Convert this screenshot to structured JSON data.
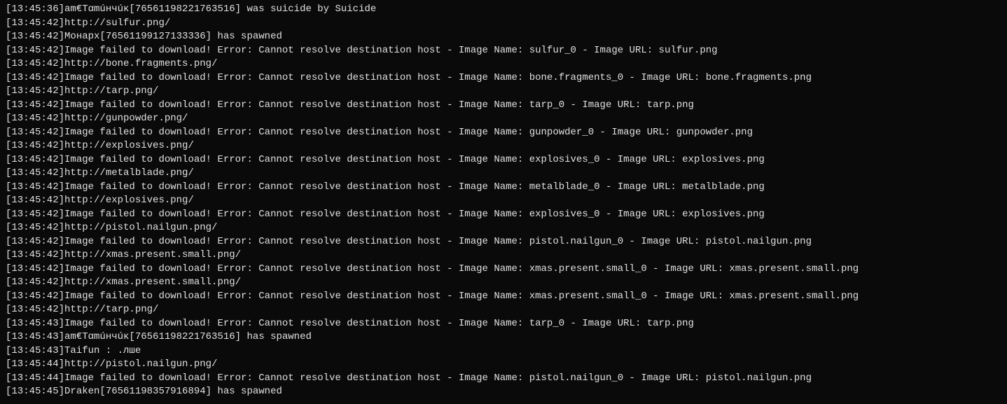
{
  "console": {
    "lines": [
      {
        "ts": "[13:45:36]",
        "text": "am€Tαmúнчúĸ[76561198221763516] was suicide by Suicide"
      },
      {
        "ts": "[13:45:42]",
        "text": "http://sulfur.png/"
      },
      {
        "ts": "[13:45:42]",
        "text": "Монарх[76561199127133336] has spawned"
      },
      {
        "ts": "[13:45:42]",
        "text": "Image failed to download! Error: Cannot resolve destination host - Image Name: sulfur_0 - Image URL: sulfur.png"
      },
      {
        "ts": "[13:45:42]",
        "text": "http://bone.fragments.png/"
      },
      {
        "ts": "[13:45:42]",
        "text": "Image failed to download! Error: Cannot resolve destination host - Image Name: bone.fragments_0 - Image URL: bone.fragments.png"
      },
      {
        "ts": "[13:45:42]",
        "text": "http://tarp.png/"
      },
      {
        "ts": "[13:45:42]",
        "text": "Image failed to download! Error: Cannot resolve destination host - Image Name: tarp_0 - Image URL: tarp.png"
      },
      {
        "ts": "[13:45:42]",
        "text": "http://gunpowder.png/"
      },
      {
        "ts": "[13:45:42]",
        "text": "Image failed to download! Error: Cannot resolve destination host - Image Name: gunpowder_0 - Image URL: gunpowder.png"
      },
      {
        "ts": "[13:45:42]",
        "text": "http://explosives.png/"
      },
      {
        "ts": "[13:45:42]",
        "text": "Image failed to download! Error: Cannot resolve destination host - Image Name: explosives_0 - Image URL: explosives.png"
      },
      {
        "ts": "[13:45:42]",
        "text": "http://metalblade.png/"
      },
      {
        "ts": "[13:45:42]",
        "text": "Image failed to download! Error: Cannot resolve destination host - Image Name: metalblade_0 - Image URL: metalblade.png"
      },
      {
        "ts": "[13:45:42]",
        "text": "http://explosives.png/"
      },
      {
        "ts": "[13:45:42]",
        "text": "Image failed to download! Error: Cannot resolve destination host - Image Name: explosives_0 - Image URL: explosives.png"
      },
      {
        "ts": "[13:45:42]",
        "text": "http://pistol.nailgun.png/"
      },
      {
        "ts": "[13:45:42]",
        "text": "Image failed to download! Error: Cannot resolve destination host - Image Name: pistol.nailgun_0 - Image URL: pistol.nailgun.png"
      },
      {
        "ts": "[13:45:42]",
        "text": "http://xmas.present.small.png/"
      },
      {
        "ts": "[13:45:42]",
        "text": "Image failed to download! Error: Cannot resolve destination host - Image Name: xmas.present.small_0 - Image URL: xmas.present.small.png"
      },
      {
        "ts": "[13:45:42]",
        "text": "http://xmas.present.small.png/"
      },
      {
        "ts": "[13:45:42]",
        "text": "Image failed to download! Error: Cannot resolve destination host - Image Name: xmas.present.small_0 - Image URL: xmas.present.small.png"
      },
      {
        "ts": "[13:45:42]",
        "text": "http://tarp.png/"
      },
      {
        "ts": "[13:45:43]",
        "text": "Image failed to download! Error: Cannot resolve destination host - Image Name: tarp_0 - Image URL: tarp.png"
      },
      {
        "ts": "[13:45:43]",
        "text": "am€Tαmúнчúĸ[76561198221763516] has spawned"
      },
      {
        "ts": "[13:45:43]",
        "text": "Taifun : .лше"
      },
      {
        "ts": "[13:45:44]",
        "text": "http://pistol.nailgun.png/"
      },
      {
        "ts": "[13:45:44]",
        "text": "Image failed to download! Error: Cannot resolve destination host - Image Name: pistol.nailgun_0 - Image URL: pistol.nailgun.png"
      },
      {
        "ts": "[13:45:45]",
        "text": "Draken[76561198357916894] has spawned"
      }
    ]
  }
}
